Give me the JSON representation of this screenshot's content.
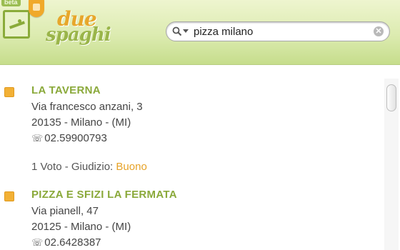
{
  "header": {
    "beta_label": "beta",
    "logo_word1": "due",
    "logo_word2": "spaghi"
  },
  "search": {
    "value": "pizza milano",
    "clear_icon": "✕"
  },
  "results": [
    {
      "name": "LA TAVERNA",
      "address": "Via francesco anzani, 3",
      "city": "20135 - Milano - (MI)",
      "phone_icon": "☏",
      "phone": "02.59900793",
      "rating_prefix": "1 Voto - Giudizio: ",
      "rating_value": "Buono"
    },
    {
      "name": "PIZZA E SFIZI LA FERMATA",
      "address": "Via pianell, 47",
      "city": "20125 - Milano - (MI)",
      "phone_icon": "☏",
      "phone": "02.6428387"
    }
  ],
  "colors": {
    "header_green": "#c6dd8c",
    "name_green": "#8aa93a",
    "accent_orange": "#f2b035",
    "rating_orange": "#e6a227"
  }
}
